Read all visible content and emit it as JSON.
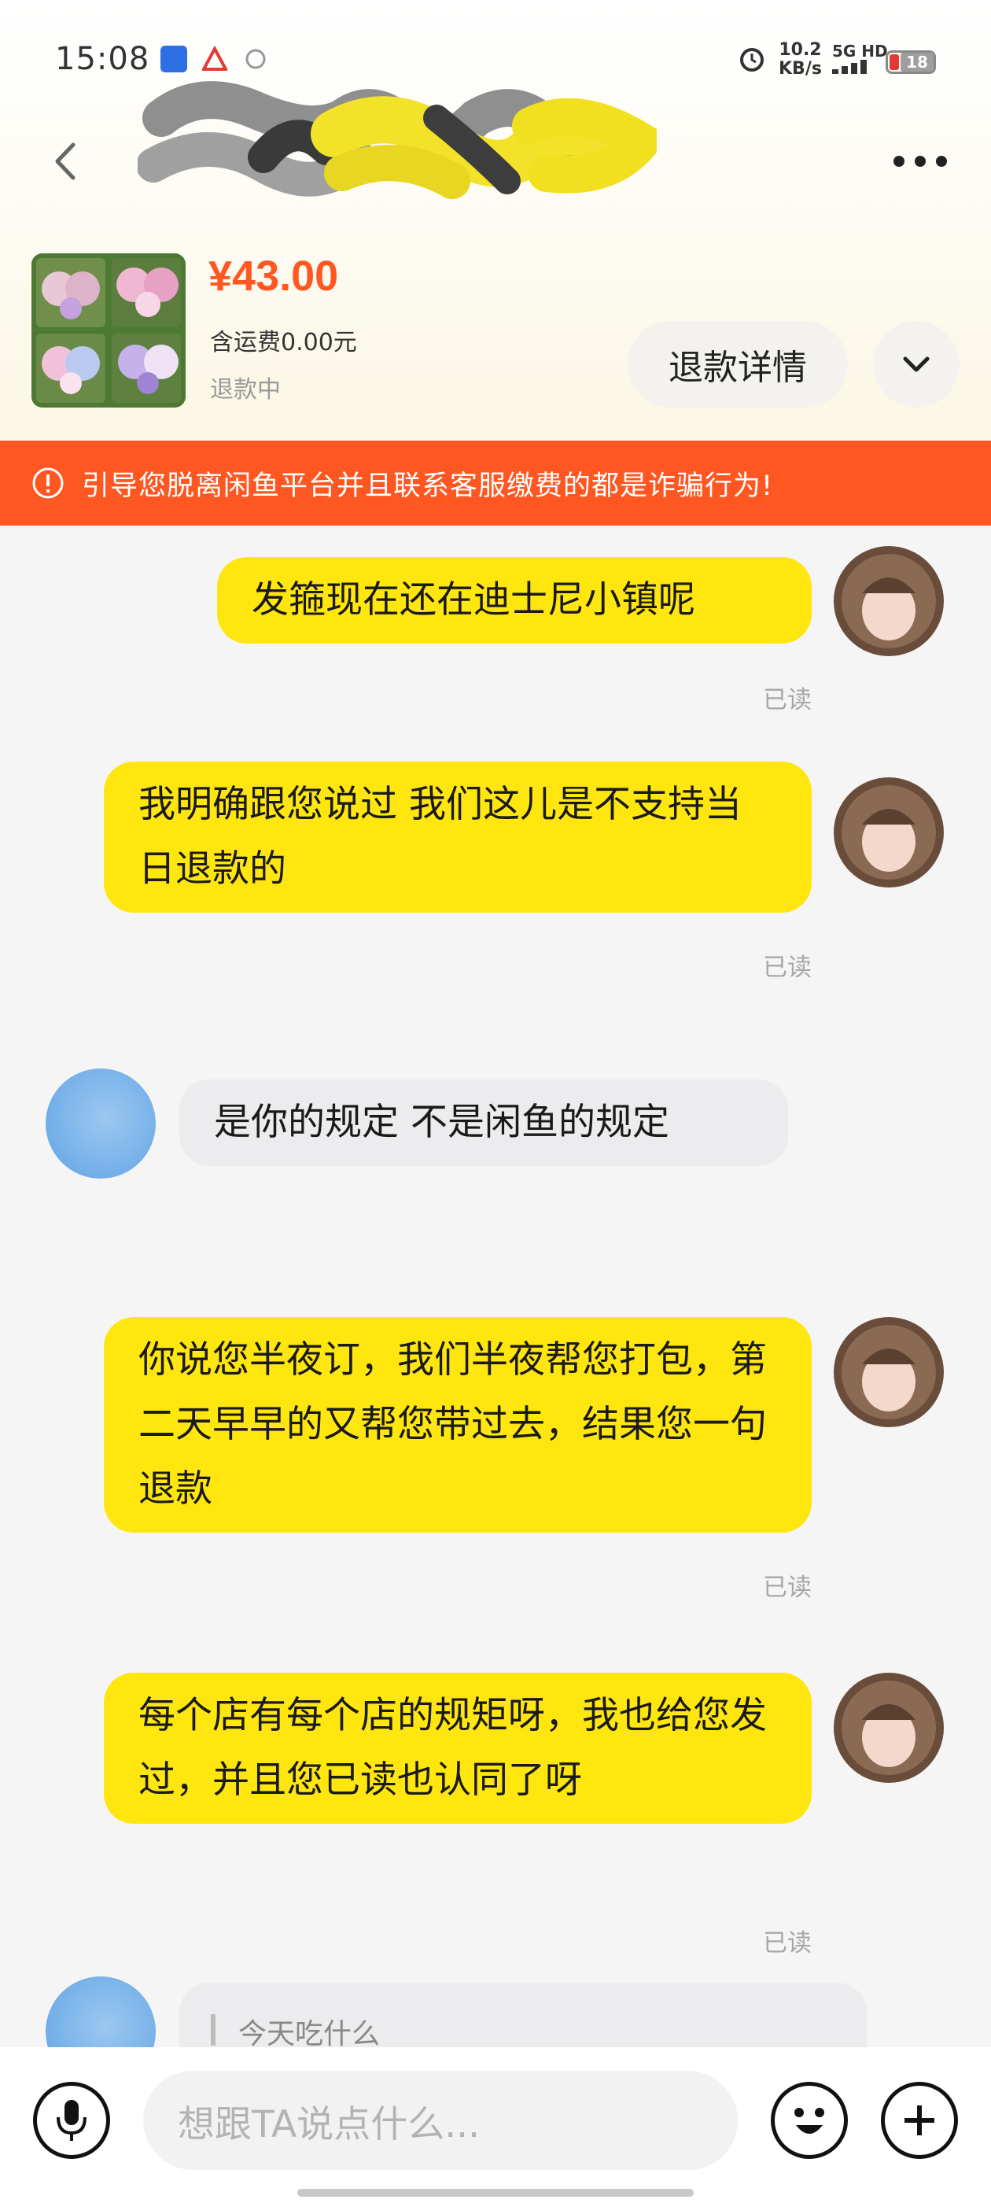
{
  "status_bar": {
    "time": "15:08",
    "net_speed_value": "10.2",
    "net_speed_unit": "KB/s",
    "signal_label": "5G HD",
    "battery_level": "18"
  },
  "product": {
    "price": "¥43.00",
    "shipping": "含运费0.00元",
    "status": "退款中",
    "refund_details_label": "退款详情"
  },
  "warning": {
    "text": "引导您脱离闲鱼平台并且联系客服缴费的都是诈骗行为!"
  },
  "messages": [
    {
      "sender": "me",
      "text": "发箍现在还在迪士尼小镇呢",
      "receipt": "已读"
    },
    {
      "sender": "me",
      "text": "我明确跟您说过 我们这儿是不支持当日退款的",
      "receipt": "已读"
    },
    {
      "sender": "other",
      "text": "是你的规定 不是闲鱼的规定"
    },
    {
      "sender": "me",
      "text": "你说您半夜订，我们半夜帮您打包，第二天早早的又帮您带过去，结果您一句退款",
      "receipt": "已读"
    },
    {
      "sender": "me",
      "text": "每个店有每个店的规矩呀，我也给您发过，并且您已读也认同了呀",
      "receipt": "已读"
    },
    {
      "sender": "other",
      "quote": "今天吃什么"
    }
  ],
  "input": {
    "placeholder": "想跟TA说点什么..."
  },
  "colors": {
    "accent_orange": "#ff5722",
    "my_bubble": "#ffe60f",
    "other_bubble": "#ececef"
  }
}
